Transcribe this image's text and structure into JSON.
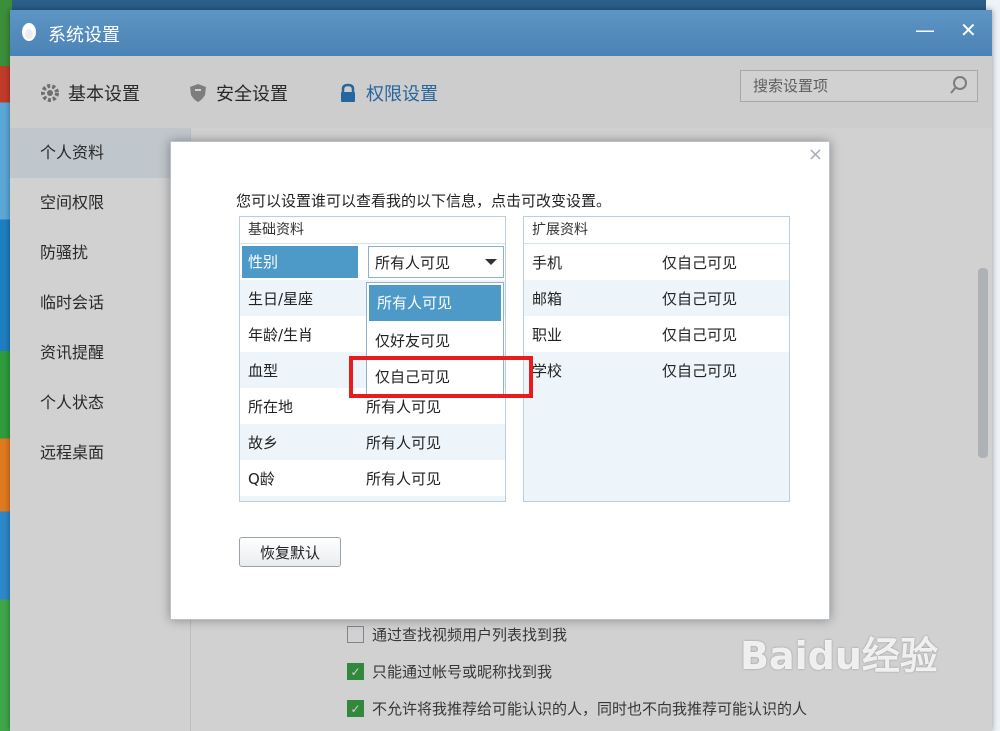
{
  "window": {
    "title": "系统设置",
    "min": "—",
    "close": "✕"
  },
  "toolbar": {
    "basic": "基本设置",
    "security": "安全设置",
    "permission": "权限设置",
    "search_placeholder": "搜索设置项"
  },
  "sidebar": {
    "items": [
      "个人资料",
      "空间权限",
      "防骚扰",
      "临时会话",
      "资讯提醒",
      "个人状态",
      "远程桌面"
    ]
  },
  "background_checks": [
    {
      "label": "通过查找视频用户列表找到我",
      "checked": false
    },
    {
      "label": "只能通过帐号或昵称找到我",
      "checked": true
    },
    {
      "label": "不允许将我推荐给可能认识的人，同时也不向我推荐可能认识的人",
      "checked": true
    }
  ],
  "dialog": {
    "close": "×",
    "intro": "您可以设置谁可以查看我的以下信息，点击可改变设置。",
    "basic_header": "基础资料",
    "ext_header": "扩展资料",
    "basic_rows": [
      {
        "k": "性别",
        "v": "所有人可见"
      },
      {
        "k": "生日/星座",
        "v": ""
      },
      {
        "k": "年龄/生肖",
        "v": ""
      },
      {
        "k": "血型",
        "v": ""
      },
      {
        "k": "所在地",
        "v": "所有人可见"
      },
      {
        "k": "故乡",
        "v": "所有人可见"
      },
      {
        "k": "Q龄",
        "v": "所有人可见"
      }
    ],
    "ext_rows": [
      {
        "k": "手机",
        "v": "仅自己可见"
      },
      {
        "k": "邮箱",
        "v": "仅自己可见"
      },
      {
        "k": "职业",
        "v": "仅自己可见"
      },
      {
        "k": "学校",
        "v": "仅自己可见"
      }
    ],
    "dropdown_selected": "所有人可见",
    "dropdown_options": [
      "所有人可见",
      "仅好友可见",
      "仅自己可见"
    ],
    "restore": "恢复默认"
  },
  "watermark": "Baidu经验",
  "colors": {
    "accent": "#4d9ac8",
    "highlight_box": "#e81c1c",
    "check_on": "#3ea64a"
  }
}
